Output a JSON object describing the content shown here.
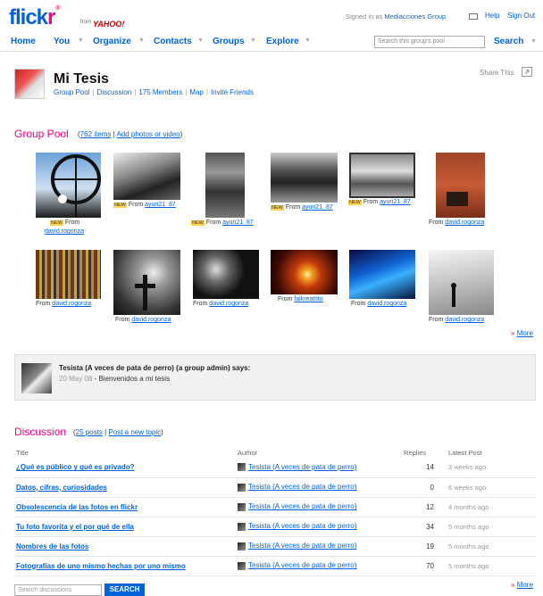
{
  "header": {
    "logo_main": "flickr",
    "logo_from": "from",
    "logo_yahoo": "YAHOO!",
    "signed_in_prefix": "Signed in as",
    "signed_in_user": "Mediacciones Group",
    "help": "Help",
    "sign_out": "Sign Out"
  },
  "nav": {
    "items": [
      {
        "label": "Home"
      },
      {
        "label": "You"
      },
      {
        "label": "Organize"
      },
      {
        "label": "Contacts"
      },
      {
        "label": "Groups"
      },
      {
        "label": "Explore"
      }
    ],
    "search_placeholder": "Search this group's pool",
    "search_label": "Search"
  },
  "group": {
    "title": "Mi Tesis",
    "links": [
      "Group Pool",
      "Discussion",
      "175 Members",
      "Map",
      "Invite Friends"
    ],
    "share": "Share This"
  },
  "pool": {
    "title": "Group Pool",
    "items_link": "762 items",
    "add_link": "Add photos or video",
    "from_label": "From",
    "new_label": "NEW",
    "photos": [
      {
        "author": "david.rogonza",
        "new": true
      },
      {
        "author": "ayuri21_87",
        "new": true
      },
      {
        "author": "ayuri21_87",
        "new": true
      },
      {
        "author": "ayuri21_87",
        "new": true
      },
      {
        "author": "ayuri21_87",
        "new": true
      },
      {
        "author": "david.rogonza",
        "new": false
      },
      {
        "author": "david.rogonza",
        "new": false
      },
      {
        "author": "david.rogonza",
        "new": false
      },
      {
        "author": "david.rogonza",
        "new": false
      },
      {
        "author": "falkreattito",
        "new": false
      },
      {
        "author": "david.rogonza",
        "new": false
      },
      {
        "author": "david.rogonza",
        "new": false
      }
    ],
    "more": "More"
  },
  "admin_message": {
    "author": "Tesista (A veces de pata de perro) (a group admin) says:",
    "date": "20 May 08",
    "text": "Bienvenidos a mi tesis"
  },
  "discussion": {
    "title": "Discussion",
    "posts_link": "25 posts",
    "new_topic_link": "Post a new topic",
    "columns": [
      "Title",
      "Author",
      "Replies",
      "Latest Post"
    ],
    "rows": [
      {
        "title": "¿Qué es público y qué es privado?",
        "author": "Tesista (A veces de pata de perro)",
        "replies": "14",
        "latest": "3 weeks ago"
      },
      {
        "title": "Datos, cifras, curiosidades",
        "author": "Tesista (A veces de pata de perro)",
        "replies": "0",
        "latest": "6 weeks ago"
      },
      {
        "title": "Obsolescencia de las fotos en flickr",
        "author": "Tesista (A veces de pata de perro)",
        "replies": "12",
        "latest": "4 months ago"
      },
      {
        "title": "Tu foto favorita y el por qué de ella",
        "author": "Tesista (A veces de pata de perro)",
        "replies": "34",
        "latest": "5 months ago"
      },
      {
        "title": "Nombres de las fotos",
        "author": "Tesista (A veces de pata de perro)",
        "replies": "19",
        "latest": "5 months ago"
      },
      {
        "title": "Fotografías de uno mismo hechas por uno mismo",
        "author": "Tesista (A veces de pata de perro)",
        "replies": "70",
        "latest": "5 months ago"
      }
    ],
    "more": "More",
    "search_placeholder": "Search discussions",
    "search_button": "SEARCH"
  },
  "colors": {
    "accent": "#0063dc",
    "brand_pink": "#ff0084"
  }
}
